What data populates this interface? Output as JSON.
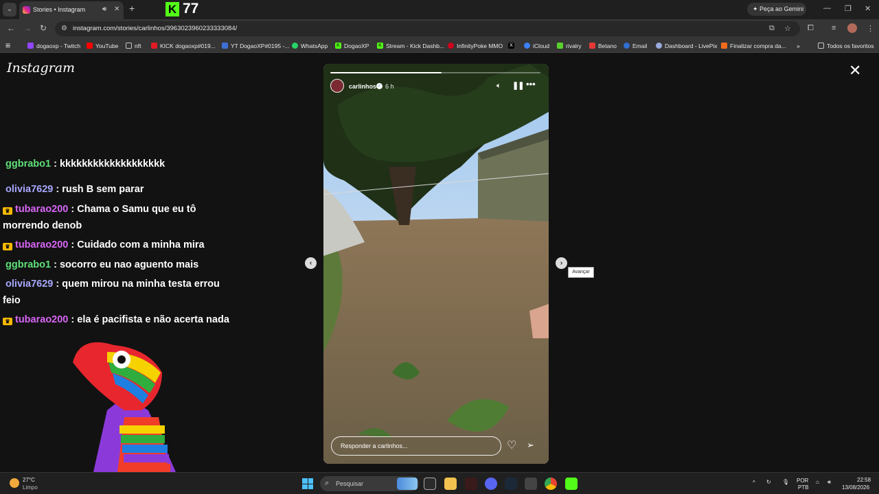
{
  "browser": {
    "tab_title": "Stories • Instagram",
    "new_tab_symbol": "+",
    "kick_viewer_count": "77",
    "gemini_label": "Peça ao Gemini",
    "url": "instagram.com/stories/carlinhos/3963023960233333084/",
    "bookmarks": [
      {
        "label": "dogaoxp - Twitch",
        "color": "#9146ff"
      },
      {
        "label": "YouTube",
        "color": "#ff0000"
      },
      {
        "label": "nft",
        "color": "#555555"
      },
      {
        "label": "KICK dogaoxp#019...",
        "color": "#e01b24"
      },
      {
        "label": "YT DogaoXP#0195 -...",
        "color": "#3d6fd6"
      },
      {
        "label": "WhatsApp",
        "color": "#25d366"
      },
      {
        "label": "DogaoXP",
        "color": "#53fc18"
      },
      {
        "label": "Stream - Kick Dashb...",
        "color": "#53fc18"
      },
      {
        "label": "InfinityPoke MMO",
        "color": "#d0021b"
      },
      {
        "label": "",
        "color": "#000000"
      },
      {
        "label": "iCloud",
        "color": "#3b82f6"
      },
      {
        "label": "rivalry",
        "color": "#59d02e"
      },
      {
        "label": "Betano",
        "color": "#e53935"
      },
      {
        "label": "Email",
        "color": "#2f6fd1"
      },
      {
        "label": "Dashboard - LivePix",
        "color": "#9ad"
      },
      {
        "label": "Finalizar compra da...",
        "color": "#f26b1d"
      }
    ],
    "more_bookmarks": "»",
    "all_favorites": "Todos os favoritos"
  },
  "page": {
    "logo": "Instagram"
  },
  "chat": [
    {
      "user": "ggbrabo1",
      "text": " : kkkkkkkkkkkkkkkkkkk",
      "color": "green",
      "crown": false
    },
    {
      "user": "olivia7629",
      "text": " : rush B sem parar",
      "color": "blue",
      "crown": false
    },
    {
      "user": "tubarao200",
      "text": " : Chama o Samu que eu tô morrendo denob",
      "color": "purple",
      "crown": true
    },
    {
      "user": "tubarao200",
      "text": " : Cuidado com a minha mira",
      "color": "purple",
      "crown": true
    },
    {
      "user": "ggbrabo1",
      "text": " : socorro eu nao aguento mais",
      "color": "green",
      "crown": false
    },
    {
      "user": "olivia7629",
      "text": " : quem mirou na minha testa errou feio",
      "color": "blue",
      "crown": false
    },
    {
      "user": "tubarao200",
      "text": " : ela é pacifista e não acerta nada",
      "color": "purple",
      "crown": true
    }
  ],
  "story": {
    "username": "carlinhos",
    "time": "6 h",
    "progress": 0.53,
    "reply_placeholder": "Responder a carlinhos...",
    "next_tooltip": "Avançar"
  },
  "taskbar": {
    "temp": "27°C",
    "condition": "Limpo",
    "search_placeholder": "Pesquisar",
    "lang_top": "POR",
    "lang_bottom": "PTB",
    "time": "22:58",
    "date": "13/08/2026"
  }
}
